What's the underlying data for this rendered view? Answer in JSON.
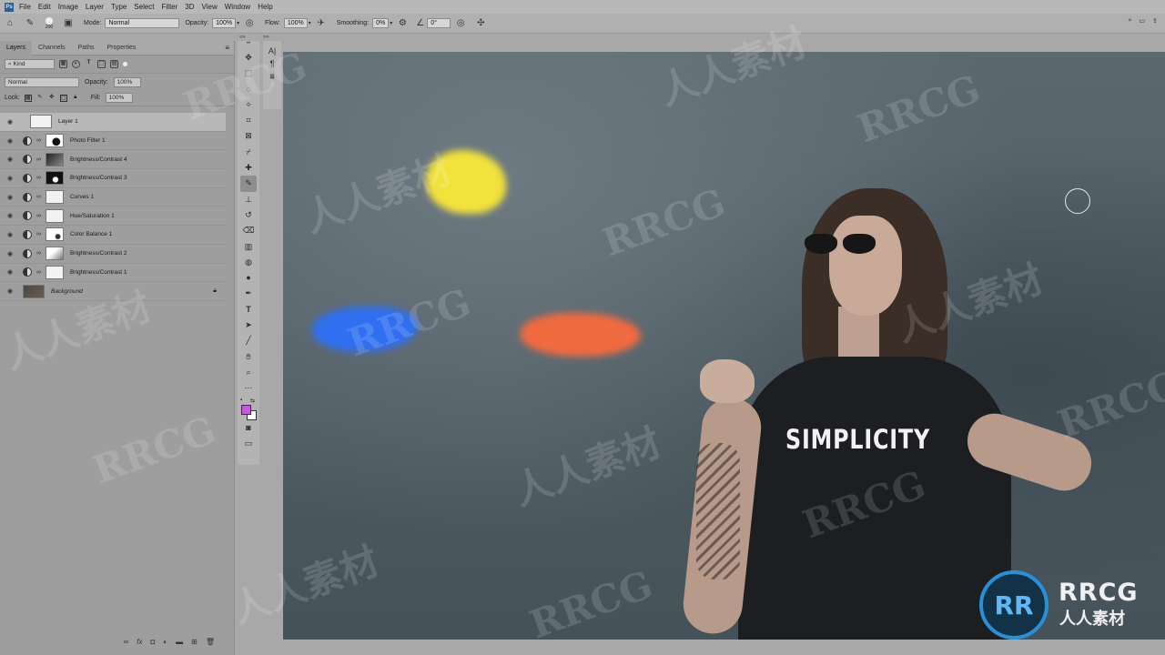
{
  "menubar": {
    "logo": "Ps",
    "items": [
      "File",
      "Edit",
      "Image",
      "Layer",
      "Type",
      "Select",
      "Filter",
      "3D",
      "View",
      "Window",
      "Help"
    ]
  },
  "options": {
    "brush_size": "200",
    "mode_label": "Mode:",
    "mode_value": "Normal",
    "opacity_label": "Opacity:",
    "opacity_value": "100%",
    "flow_label": "Flow:",
    "flow_value": "100%",
    "smoothing_label": "Smoothing:",
    "smoothing_value": "0%",
    "angle_value": "0°"
  },
  "panel": {
    "tabs": [
      "Layers",
      "Channels",
      "Paths",
      "Properties"
    ],
    "filter_kind": "Kind",
    "blend_mode": "Normal",
    "opacity_label": "Opacity:",
    "opacity_value": "100%",
    "lock_label": "Lock:",
    "fill_label": "Fill:",
    "fill_value": "100%"
  },
  "layers": [
    {
      "name": "Layer 1",
      "type": "pixel",
      "selected": true
    },
    {
      "name": "Photo Filter 1",
      "type": "adjustment",
      "thumb": "mask"
    },
    {
      "name": "Brightness/Contrast 4",
      "type": "adjustment",
      "thumb": "dark"
    },
    {
      "name": "Brightness/Contrast 3",
      "type": "adjustment",
      "thumb": "mask"
    },
    {
      "name": "Curves 1",
      "type": "adjustment",
      "thumb": "white"
    },
    {
      "name": "Hue/Saturation 1",
      "type": "adjustment",
      "thumb": "white"
    },
    {
      "name": "Color Balance 1",
      "type": "adjustment",
      "thumb": "white"
    },
    {
      "name": "Brightness/Contrast 2",
      "type": "adjustment",
      "thumb": "white"
    },
    {
      "name": "Brightness/Contrast 1",
      "type": "adjustment",
      "thumb": "white"
    },
    {
      "name": "Background",
      "type": "background",
      "locked": true
    }
  ],
  "colors": {
    "foreground": "#c45bdc",
    "background": "#ffffff",
    "paint_yellow": "#f2e23c",
    "paint_blue": "#2f6ff0",
    "paint_orange": "#f06a40"
  },
  "canvas": {
    "shirt_text": "SIMPLICITY"
  },
  "watermark": {
    "latin": "RRCG",
    "cjk": "人人素材",
    "badge": "RR",
    "brand": "RRCG",
    "brand_sub": "人人素材"
  }
}
